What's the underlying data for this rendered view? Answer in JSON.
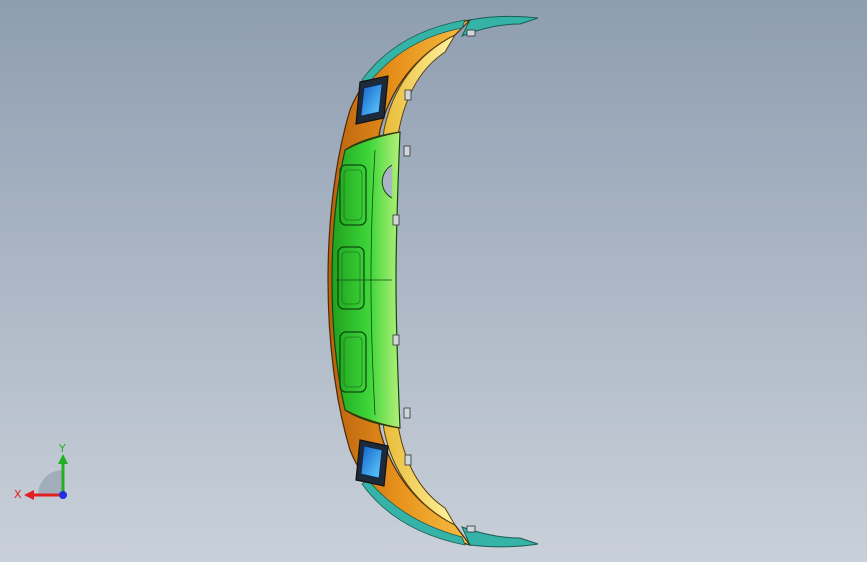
{
  "triad": {
    "x_label": "X",
    "y_label": "Y",
    "x_color": "#e02020",
    "y_color": "#20b020",
    "z_color": "#2030e0"
  },
  "colors": {
    "background_top": "#8e9db0",
    "background_bottom": "#c9d0d9",
    "part_orange": "#e8921c",
    "part_yellow": "#f2d24a",
    "part_green": "#3ed63a",
    "part_teal": "#34b3a6",
    "part_blue": "#2a86e8"
  }
}
